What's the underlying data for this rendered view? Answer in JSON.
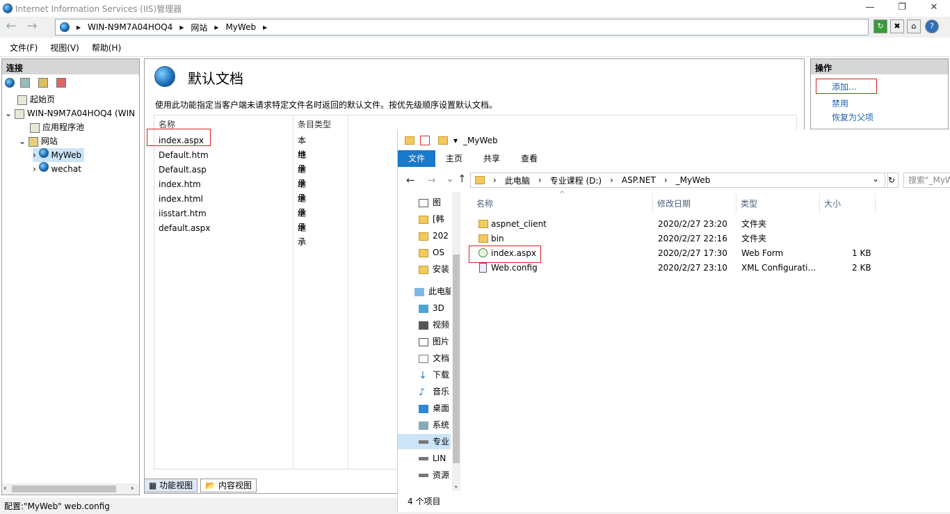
{
  "window": {
    "title": "Internet Information Services (IIS)管理器"
  },
  "address": {
    "crumbs": [
      "WIN-N9M7A04HOQ4",
      "网站",
      "MyWeb"
    ]
  },
  "menu": [
    "文件(F)",
    "视图(V)",
    "帮助(H)"
  ],
  "left": {
    "header": "连接",
    "tree": [
      "起始页",
      "WIN-N9M7A04HOQ4 (WIN",
      "应用程序池",
      "网站",
      "MyWeb",
      "wechat"
    ]
  },
  "center": {
    "title": "默认文档",
    "description": "使用此功能指定当客户端未请求特定文件名时返回的默认文件。按优先级顺序设置默认文档。",
    "columns": [
      "名称",
      "条目类型"
    ],
    "rows": [
      {
        "name": "index.aspx",
        "type": "本地"
      },
      {
        "name": "Default.htm",
        "type": "继承"
      },
      {
        "name": "Default.asp",
        "type": "继承"
      },
      {
        "name": "index.htm",
        "type": "继承"
      },
      {
        "name": "index.html",
        "type": "继承"
      },
      {
        "name": "iisstart.htm",
        "type": "继承"
      },
      {
        "name": "default.aspx",
        "type": "继承"
      }
    ],
    "tabs": [
      "功能视图",
      "内容视图"
    ]
  },
  "right": {
    "header": "操作",
    "actions": [
      "添加...",
      "禁用",
      "恢复为父项"
    ]
  },
  "status": "配置:\"MyWeb\" web.config",
  "explorer": {
    "title": "_MyWeb",
    "ribbon": [
      "文件",
      "主页",
      "共享",
      "查看"
    ],
    "path": [
      "此电脑",
      "专业课程 (D:)",
      "ASP.NET",
      "_MyWeb"
    ],
    "search": "搜索\"_MyW",
    "nav": [
      "图",
      "[韩",
      "202",
      "OS",
      "安装",
      "此电脑",
      "3D",
      "视频",
      "图片",
      "文档",
      "下载",
      "音乐",
      "桌面",
      "系统",
      "专业",
      "LIN",
      "资源"
    ],
    "columns": [
      "名称",
      "修改日期",
      "类型",
      "大小"
    ],
    "files": [
      {
        "name": "aspnet_client",
        "date": "2020/2/27 23:20",
        "type": "文件夹",
        "size": ""
      },
      {
        "name": "bin",
        "date": "2020/2/27 22:16",
        "type": "文件夹",
        "size": ""
      },
      {
        "name": "index.aspx",
        "date": "2020/2/27 17:30",
        "type": "Web Form",
        "size": "1 KB"
      },
      {
        "name": "Web.config",
        "date": "2020/2/27 23:10",
        "type": "XML Configurati...",
        "size": "2 KB"
      }
    ],
    "count": "4 个项目"
  }
}
